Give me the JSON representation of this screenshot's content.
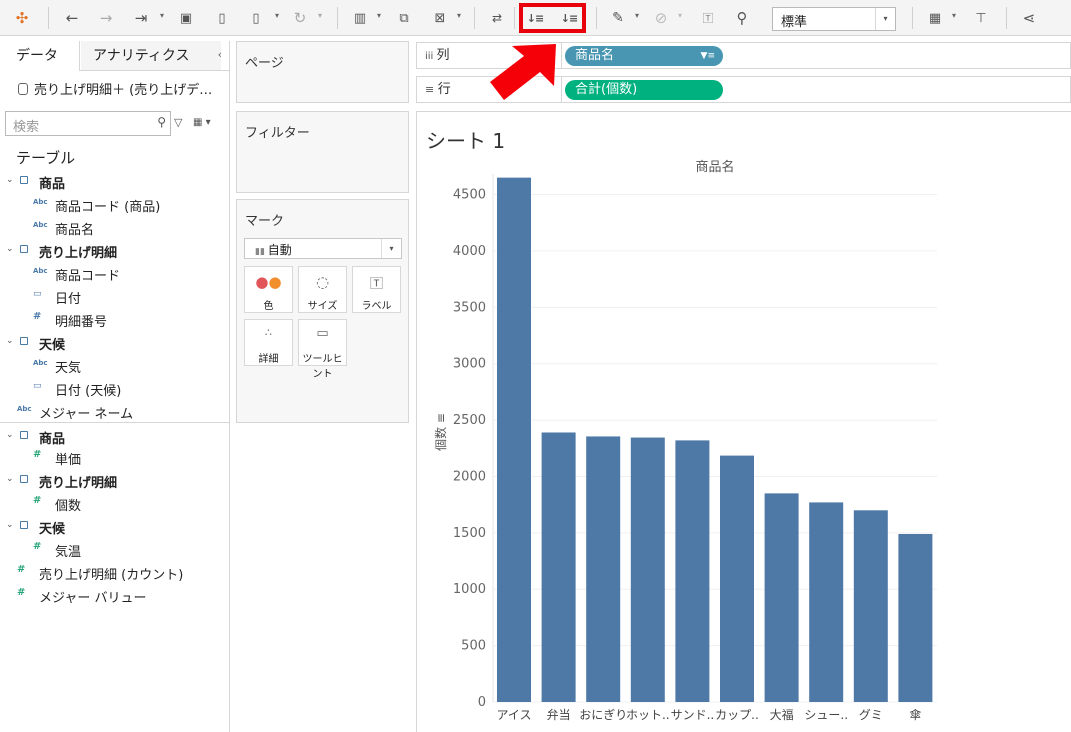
{
  "toolbar": {
    "fit_value": "標準",
    "icons": [
      "tableau-logo-icon",
      "undo-icon",
      "redo-icon",
      "replay-icon",
      "save-icon",
      "new-datasource-icon",
      "pause-icon",
      "refresh-icon",
      "new-sheet-icon",
      "duplicate-icon",
      "clear-icon",
      "swap-icon",
      "sort-ascending-icon",
      "sort-descending-icon",
      "highlight-icon",
      "group-icon",
      "label-icon",
      "pin-icon",
      "show-me-icon",
      "presentation-icon",
      "share-icon"
    ]
  },
  "data_panel": {
    "tab_data": "データ",
    "tab_analytics": "アナリティクス",
    "datasource": "売り上げ明細＋ (売り上げデ…",
    "search_placeholder": "検索",
    "tables_heading": "テーブル",
    "rows": [
      {
        "kind": "table",
        "label": "商品",
        "level": 0
      },
      {
        "kind": "dim",
        "label": "商品コード (商品)",
        "level": 1
      },
      {
        "kind": "dim",
        "label": "商品名",
        "level": 1
      },
      {
        "kind": "table",
        "label": "売り上げ明細",
        "level": 0
      },
      {
        "kind": "dim",
        "label": "商品コード",
        "level": 1
      },
      {
        "kind": "date",
        "label": "日付",
        "level": 1
      },
      {
        "kind": "dimnum",
        "label": "明細番号",
        "level": 1
      },
      {
        "kind": "table",
        "label": "天候",
        "level": 0
      },
      {
        "kind": "dim",
        "label": "天気",
        "level": 1
      },
      {
        "kind": "date",
        "label": "日付 (天候)",
        "level": 1
      },
      {
        "kind": "dimtop",
        "label": "メジャー ネーム",
        "level": 0
      },
      {
        "kind": "table",
        "label": "商品",
        "level": 0
      },
      {
        "kind": "meas",
        "label": "単価",
        "level": 1
      },
      {
        "kind": "table",
        "label": "売り上げ明細",
        "level": 0
      },
      {
        "kind": "meas",
        "label": "個数",
        "level": 1
      },
      {
        "kind": "table",
        "label": "天候",
        "level": 0
      },
      {
        "kind": "meas",
        "label": "気温",
        "level": 1
      },
      {
        "kind": "meastop",
        "label": "売り上げ明細 (カウント)",
        "level": 0
      },
      {
        "kind": "meastop",
        "label": "メジャー バリュー",
        "level": 0
      }
    ]
  },
  "shelves": {
    "pages": "ページ",
    "filters": "フィルター",
    "marks": "マーク",
    "marks_type": "自動",
    "mark_buttons": [
      {
        "icon": "color-icon",
        "label": "色"
      },
      {
        "icon": "size-icon",
        "label": "サイズ"
      },
      {
        "icon": "label-icon",
        "label": "ラベル"
      },
      {
        "icon": "detail-icon",
        "label": "詳細"
      },
      {
        "icon": "tooltip-icon",
        "label": "ツールヒント"
      }
    ],
    "columns_label": "列",
    "rows_label": "行",
    "columns_pill": "商品名",
    "rows_pill": "合計(個数)"
  },
  "sheet": {
    "title": "シート 1"
  },
  "chart_data": {
    "type": "bar",
    "title": "商品名",
    "ylabel": "個数",
    "categories": [
      "アイス",
      "弁当",
      "おにぎり",
      "ホット..",
      "サンド..",
      "カップ..",
      "大福",
      "シュー..",
      "グミ",
      "傘"
    ],
    "values": [
      4650,
      2390,
      2355,
      2345,
      2320,
      2185,
      1850,
      1770,
      1700,
      1490
    ],
    "ylim": [
      0,
      4700
    ],
    "yticks": [
      0,
      500,
      1000,
      1500,
      2000,
      2500,
      3000,
      3500,
      4000,
      4500
    ],
    "bar_color": "#4e79a7",
    "grid": true
  },
  "colors": {
    "highlight": "#e8000b",
    "pill_columns": "#4996b2",
    "pill_rows": "#00b180"
  }
}
